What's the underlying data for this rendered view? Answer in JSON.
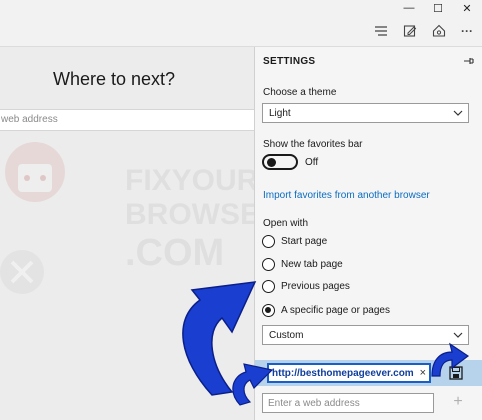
{
  "window": {
    "controls": {
      "minimize": "—",
      "maximize": "☐",
      "close": "✕"
    }
  },
  "toolbar": {
    "icons": [
      "hub-icon",
      "web-note-icon",
      "share-icon",
      "more-icon"
    ],
    "more_label": "···"
  },
  "page": {
    "heading": "Where to next?",
    "address_placeholder": "web address",
    "watermark": {
      "line1": "FIXYOUR",
      "line2": "BROWSER",
      "line3": ".COM"
    }
  },
  "settings": {
    "title": "SETTINGS",
    "theme": {
      "label": "Choose a theme",
      "value": "Light"
    },
    "favorites_bar": {
      "label": "Show the favorites bar",
      "state": "Off"
    },
    "import_link": "Import favorites from another browser",
    "open_with": {
      "label": "Open with",
      "options": [
        {
          "label": "Start page",
          "selected": false
        },
        {
          "label": "New tab page",
          "selected": false
        },
        {
          "label": "Previous pages",
          "selected": false
        },
        {
          "label": "A specific page or pages",
          "selected": true
        }
      ]
    },
    "page_select": {
      "value": "Custom"
    },
    "url_entry": {
      "value": "http://besthomepageever.com",
      "clear": "×"
    },
    "new_entry": {
      "placeholder": "Enter a web address",
      "add": "+"
    }
  },
  "colors": {
    "accent_link": "#0a6cc2",
    "highlight_bar": "#b7d3ec",
    "annotation_arrow": "#1a3fd0"
  }
}
